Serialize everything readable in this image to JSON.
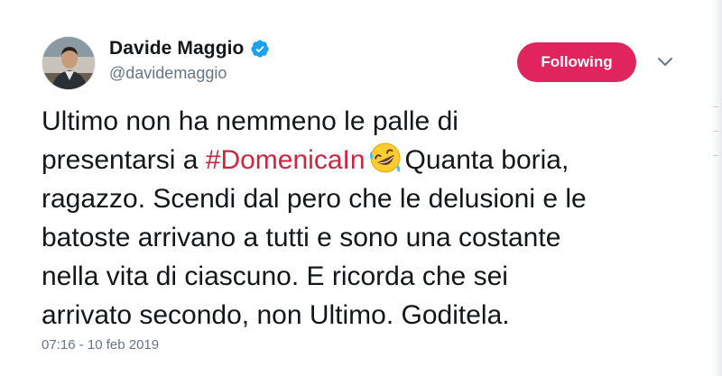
{
  "author": {
    "display_name": "Davide Maggio",
    "handle": "@davidemaggio",
    "verified": true
  },
  "follow_button": {
    "label": "Following",
    "color": "#e0245e"
  },
  "menu": {
    "icon": "chevron-down-icon"
  },
  "tweet": {
    "line1": "Ultimo non ha nemmeno le palle di",
    "line2_prefix": "presentarsi a ",
    "hashtag": "#DomenicaIn",
    "emoji": "rolling-on-floor-laughing-emoji",
    "line2_suffix": "Quanta boria,",
    "line3": "ragazzo. Scendi dal pero che le delusioni e le",
    "line4": "batoste arrivano a tutti e sono una costante",
    "line5": "nella vita di ciascuno. E ricorda che sei",
    "line6": "arrivato secondo, non Ultimo. Goditela."
  },
  "timestamp": "07:16 - 10 feb 2019",
  "colors": {
    "text": "#14171a",
    "secondary": "#657786",
    "hashtag": "#d0243f",
    "verified": "#1da1f2"
  }
}
